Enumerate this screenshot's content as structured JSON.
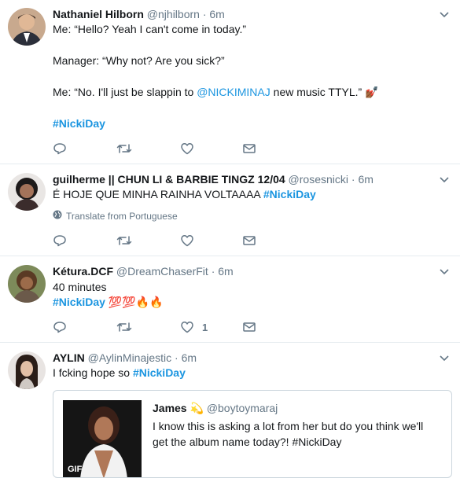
{
  "tweets": [
    {
      "name": "Nathaniel Hilborn",
      "handle": "@njhilborn",
      "dot": "·",
      "time": "6m",
      "line1": "Me: “Hello? Yeah I can't come in today.”",
      "line2": "Manager: “Why not? Are you sick?”",
      "line3_prefix": "Me: “No. I'll just be slappin to ",
      "mention": "@NICKIMINAJ",
      "line3_suffix": " new music TTYL.” ",
      "emoji": "💅🏾",
      "hashtag": "#NickiDay"
    },
    {
      "name": "guilherme || CHUN LI & BARBIE TINGZ 12/04",
      "handle": "@rosesnicki",
      "dot": "·",
      "time": "6m",
      "text": "É HOJE QUE MINHA RAINHA VOLTAAAA ",
      "hashtag": "#NickiDay",
      "translate": "Translate from Portuguese"
    },
    {
      "name": "Kétura.DCF",
      "handle": "@DreamChaserFit",
      "dot": "·",
      "time": "6m",
      "line1": "40 minutes",
      "hashtag": "#NickiDay",
      "emoji": " 💯💯🔥🔥",
      "like_count": "1"
    },
    {
      "name": "AYLIN",
      "handle": "@AylinMinajestic",
      "dot": "·",
      "time": "6m",
      "text": "I fcking hope so ",
      "hashtag": "#NickiDay",
      "quote": {
        "name": "James",
        "emoji": "💫",
        "handle": "@boytoymaraj",
        "line1": "I know this is asking a lot from her but do you think we'll",
        "line2": "get the album name today?! #NickiDay",
        "badge": "GIF"
      }
    }
  ],
  "colors": {
    "link": "#1b95e0",
    "muted": "#657786",
    "border": "#e6ecf0"
  },
  "icons": [
    "reply-icon",
    "retweet-icon",
    "like-icon",
    "dm-icon",
    "chevron-down-icon",
    "globe-icon"
  ]
}
